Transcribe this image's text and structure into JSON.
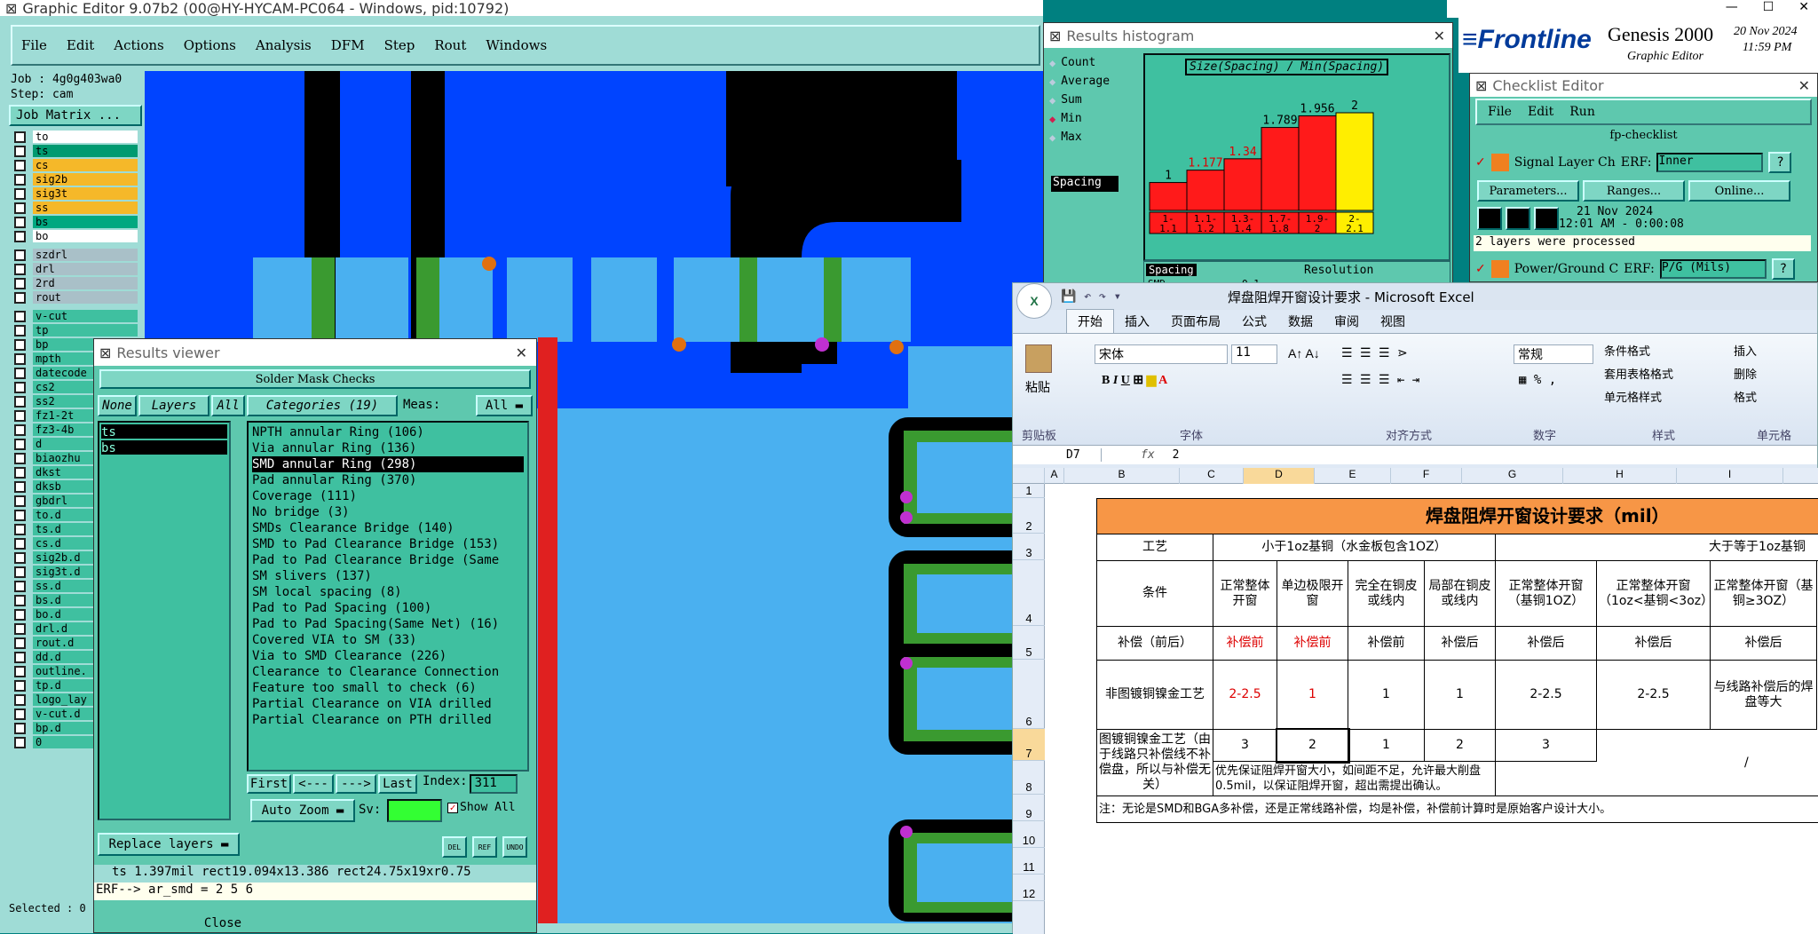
{
  "main_window": {
    "title": "Graphic Editor 9.07b2 (00@HY-HYCAM-PC064 - Windows, pid:10792)",
    "menu": [
      "File",
      "Edit",
      "Actions",
      "Options",
      "Analysis",
      "DFM",
      "Step",
      "Rout",
      "Windows"
    ],
    "job_label": "Job : 4g0g403wa0",
    "step_label": "Step: cam",
    "job_matrix_btn": "Job Matrix ...",
    "layers": [
      {
        "name": "to",
        "color": "#ffffff"
      },
      {
        "name": "ts",
        "color": "#009a70"
      },
      {
        "name": "cs",
        "color": "#f5b829"
      },
      {
        "name": "sig2b",
        "color": "#f5b829"
      },
      {
        "name": "sig3t",
        "color": "#f5b829"
      },
      {
        "name": "ss",
        "color": "#f5b829"
      },
      {
        "name": "bs",
        "color": "#00a880"
      },
      {
        "name": "bo",
        "color": "#ffffff"
      },
      {
        "name": "szdrl",
        "color": "#a9c0c8"
      },
      {
        "name": "drl",
        "color": "#a9c0c8"
      },
      {
        "name": "2rd",
        "color": "#a9c0c8"
      },
      {
        "name": "rout",
        "color": "#a9c0c8"
      },
      {
        "name": "v-cut",
        "color": "#3fc0a0"
      },
      {
        "name": "tp",
        "color": "#3fc0a0"
      },
      {
        "name": "bp",
        "color": "#3fc0a0"
      },
      {
        "name": "mpth",
        "color": "#3fc0a0"
      },
      {
        "name": "datecode",
        "color": "#3fc0a0"
      },
      {
        "name": "cs2",
        "color": "#3fc0a0"
      },
      {
        "name": "ss2",
        "color": "#3fc0a0"
      },
      {
        "name": "fz1-2t",
        "color": "#3fc0a0"
      },
      {
        "name": "fz3-4b",
        "color": "#3fc0a0"
      },
      {
        "name": "d",
        "color": "#3fc0a0"
      },
      {
        "name": "biaozhu",
        "color": "#3fc0a0"
      },
      {
        "name": "dkst",
        "color": "#3fc0a0"
      },
      {
        "name": "dksb",
        "color": "#3fc0a0"
      },
      {
        "name": "gbdrl",
        "color": "#3fc0a0"
      },
      {
        "name": "to.d",
        "color": "#3fc0a0"
      },
      {
        "name": "ts.d",
        "color": "#3fc0a0"
      },
      {
        "name": "cs.d",
        "color": "#3fc0a0"
      },
      {
        "name": "sig2b.d",
        "color": "#3fc0a0"
      },
      {
        "name": "sig3t.d",
        "color": "#3fc0a0"
      },
      {
        "name": "ss.d",
        "color": "#3fc0a0"
      },
      {
        "name": "bs.d",
        "color": "#3fc0a0"
      },
      {
        "name": "bo.d",
        "color": "#3fc0a0"
      },
      {
        "name": "drl.d",
        "color": "#3fc0a0"
      },
      {
        "name": "rout.d",
        "color": "#3fc0a0"
      },
      {
        "name": "dd.d",
        "color": "#3fc0a0"
      },
      {
        "name": "outline.",
        "color": "#3fc0a0"
      },
      {
        "name": "tp.d",
        "color": "#3fc0a0"
      },
      {
        "name": "logo_lay",
        "color": "#3fc0a0"
      },
      {
        "name": "v-cut.d",
        "color": "#3fc0a0"
      },
      {
        "name": "bp.d",
        "color": "#3fc0a0"
      },
      {
        "name": "0",
        "color": "#3fc0a0"
      }
    ],
    "selected": "Selected : 0"
  },
  "results_viewer": {
    "title": "Results viewer",
    "header": "Solder Mask Checks",
    "none_btn": "None",
    "layers_btn": "Layers",
    "all_btn": "All",
    "categories_btn": "Categories (19)",
    "meas_label": "Meas:",
    "meas_value": "All",
    "layers": [
      "ts",
      "bs"
    ],
    "categories": [
      "NPTH annular Ring (106)",
      "Via annular Ring (136)",
      "SMD annular Ring (298)",
      "Pad annular Ring (370)",
      "Coverage (111)",
      "No bridge (3)",
      "SMDs Clearance Bridge (140)",
      "SMD to Pad Clearance Bridge (153)",
      "Pad to Pad Clearance Bridge (Same",
      "SM slivers (137)",
      "SM local spacing (8)",
      "Pad to Pad Spacing (100)",
      "Pad to Pad Spacing(Same Net) (16)",
      "Covered VIA to SM (33)",
      "Via to SMD Clearance (226)",
      "Clearance to Clearance Connection",
      "Feature too small to check (6)",
      "Partial Clearance on VIA drilled",
      "Partial Clearance on PTH drilled"
    ],
    "nav": [
      "First",
      "<---",
      "--->",
      "Last"
    ],
    "index_label": "Index:",
    "index_value": "311",
    "auto_zoom": "Auto Zoom",
    "sv_label": "Sv:",
    "show_all": "Show All",
    "replace_layers": "Replace layers",
    "tool_btns": [
      "DEL",
      "REF",
      "UNDO"
    ],
    "status1": "ts 1.397mil  rect19.094x13.386  rect24.75x19xr0.75",
    "status2": "ERF--> ar_smd = 2 5 6",
    "close": "Close"
  },
  "histogram": {
    "title": "Results histogram",
    "options": [
      "Count",
      "Average",
      "Sum",
      "Min",
      "Max"
    ],
    "selected_option": "Min",
    "field": "Spacing",
    "heading": "Size(Spacing) / Min(Spacing)",
    "bars": [
      {
        "label": "1",
        "value": 1,
        "range": "1-\n1.1",
        "color": "#ff1a1a",
        "lc": "#000"
      },
      {
        "label": "1.177",
        "value": 1.177,
        "range": "1.1-\n1.2",
        "color": "#ff1a1a",
        "lc": "#d00"
      },
      {
        "label": "1.34",
        "value": 1.34,
        "range": "1.3-\n1.4",
        "color": "#ff1a1a",
        "lc": "#d00"
      },
      {
        "label": "1.789",
        "value": 1.789,
        "range": "1.7-\n1.8",
        "color": "#ff1a1a",
        "lc": "#000"
      },
      {
        "label": "1.956",
        "value": 1.956,
        "range": "1.9-\n2",
        "color": "#ff1a1a",
        "lc": "#000"
      },
      {
        "label": "2",
        "value": 2,
        "range": "2-\n2.1",
        "color": "#ffee00",
        "lc": "#000"
      }
    ],
    "resolution": "Resolution",
    "field2": "Spacing",
    "smd": "SMD",
    "res_val": "0.1"
  },
  "frontline": {
    "brand": "Frontline",
    "product": "Genesis 2000",
    "sub": "Graphic Editor",
    "date": "20 Nov 2024",
    "time": "11:59 PM"
  },
  "checklist": {
    "title": "Checklist Editor",
    "menu": [
      "File",
      "Edit",
      "Run"
    ],
    "name": "fp-checklist",
    "row1": "Signal Layer Ch",
    "erf": "ERF:",
    "erf1": "Inner",
    "btns": [
      "Parameters...",
      "Ranges...",
      "Online..."
    ],
    "date": "21 Nov 2024",
    "time": "12:01 AM - 0:00:08",
    "msg": "2 layers were processed",
    "row2": "Power/Ground C",
    "erf2": "P/G (Mils)"
  },
  "excel": {
    "title": "焊盘阻焊开窗设计要求 - Microsoft Excel",
    "tabs": [
      "开始",
      "插入",
      "页面布局",
      "公式",
      "数据",
      "审阅",
      "视图"
    ],
    "font": "宋体",
    "size": "11",
    "numfmt": "常规",
    "paste": "粘贴",
    "groups": [
      "剪贴板",
      "字体",
      "对齐方式",
      "数字",
      "样式",
      "单元格"
    ],
    "styles": [
      "条件格式",
      "套用表格格式",
      "单元格样式"
    ],
    "cells": [
      "插入",
      "删除",
      "格式"
    ],
    "namebox": "D7",
    "formula": "2",
    "cols": [
      "A",
      "B",
      "C",
      "D",
      "E",
      "F",
      "G",
      "H",
      "I"
    ],
    "rows": [
      "1",
      "2",
      "3",
      "4",
      "5",
      "6",
      "7",
      "8",
      "9",
      "10",
      "11",
      "12"
    ],
    "sheet": {
      "title": "焊盘阻焊开窗设计要求（mil）",
      "r3a": "工艺",
      "r3b": "小于1oz基铜（水金板包含1OZ）",
      "r3c": "大于等于1oz基铜",
      "r4": [
        "条件",
        "正常整体开窗",
        "单边极限开窗",
        "完全在铜皮或线内",
        "局部在铜皮或线内",
        "正常整体开窗（基铜1OZ）",
        "正常整体开窗（1oz<基铜<3oz）",
        "正常整体开窗（基铜≥3OZ）"
      ],
      "r5": [
        "补偿（前后）",
        "补偿前",
        "补偿前",
        "补偿前",
        "补偿后",
        "补偿后",
        "补偿后",
        "补偿后"
      ],
      "r6": [
        "非图镀铜镍金工艺",
        "2-2.5",
        "1",
        "1",
        "1",
        "2-2.5",
        "2-2.5",
        "与线路补偿后的焊盘等大"
      ],
      "r7": [
        "图镀铜镍金工艺（由于线路只补偿线不补偿盘，所以与补偿无关）",
        "3",
        "2",
        "1",
        "2",
        "3"
      ],
      "r7slash": "/",
      "r8": "优先保证阻焊开窗大小，如间距不足，允许最大削盘0.5mil，以保证阻焊开窗，超出需提出确认。",
      "r9": "注：无论是SMD和BGA多补偿，还是正常线路补偿，均是补偿，补偿前计算时是原始客户设计大小。"
    }
  }
}
